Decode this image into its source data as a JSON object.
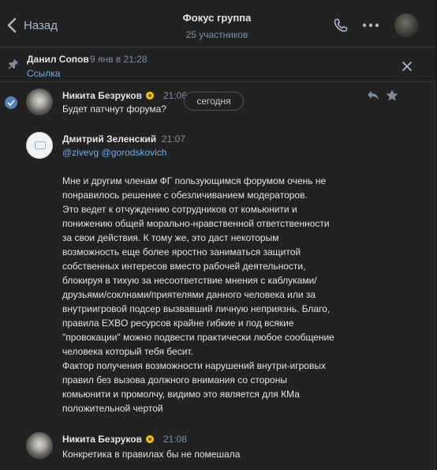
{
  "header": {
    "back_label": "Назад",
    "title": "Фокус группа",
    "subtitle": "25 участников"
  },
  "pinned": {
    "author": "Данил Сопов",
    "time": "9 янв в 21:28",
    "link_label": "Ссылка"
  },
  "date_separator": "сегодня",
  "messages": [
    {
      "author": "Никита Безруков",
      "time": "21:06",
      "text": "Будет патчнут форума?"
    },
    {
      "author": "Дмитрий Зеленский",
      "time": "21:07",
      "mention_1": "@zivevg",
      "mention_2": "@gorodskovich",
      "text": "Мне и другим членам ФГ пользующимся форумом очень не\nпонравилось решение с обезличиванием модераторов.\nЭто ведет к отчуждению сотрудников от комьюнити и\nпонижению общей морально-нравственной ответственности\nза свои действия. К тому же, это даст некоторым\nвозможность еще более яростно заниматься защитой\nсобственных интересов вместо рабочей деятельности,\nблокируя в тихую за несоответствие мнения с каблуками/\nдрузьями/соклнами/приятелями данного человека или за\nвнутриигровой подсер вызвавший личную неприязнь. Благо,\nправила EXBO ресурсов крайне гибкие и под всякие\n\"провокации\" можно подвести практически любое сообщение\nчеловека который тебя бесит.\nФактор получения возможности нарушений внутри-игровых\nправил без вызова должного внимания со стороны\nкомьюнити и промолчу, видимо это является для КМа\nположительной чертой"
    },
    {
      "author": "Никита Безруков",
      "time": "21:08",
      "text": "Конкретика в правилах бы не помешала"
    }
  ],
  "colors": {
    "background": "#222222",
    "accent": "#71aaeb",
    "text": "#e1e3e6",
    "muted": "#818c99"
  },
  "icons": [
    "chevron-left-icon",
    "phone-icon",
    "more-icon",
    "pin-icon",
    "close-icon",
    "check-icon",
    "reply-icon",
    "star-icon",
    "verified-badge-icon"
  ]
}
